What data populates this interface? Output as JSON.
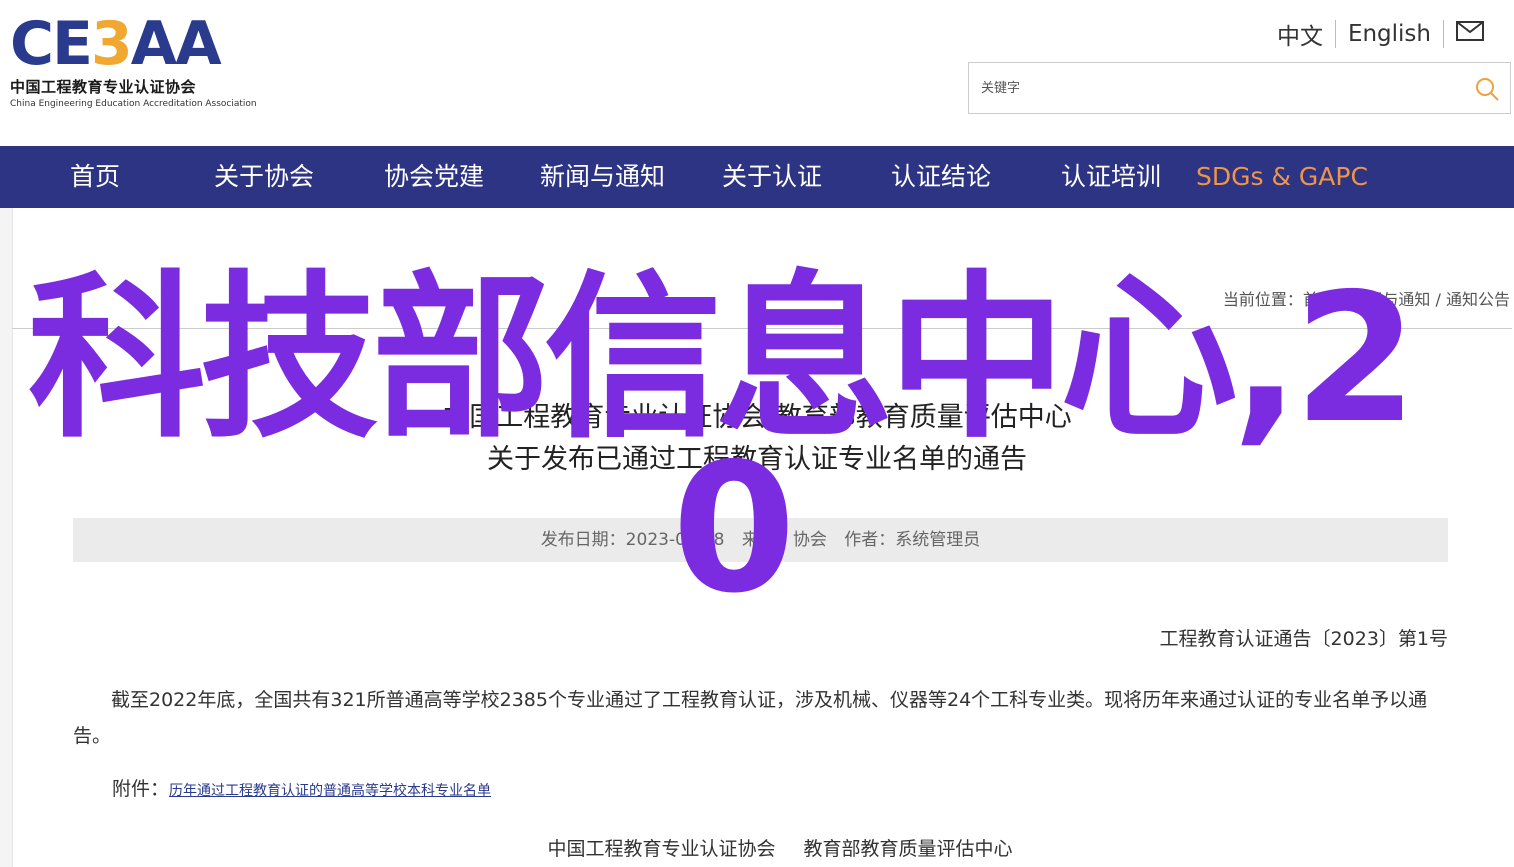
{
  "logo": {
    "mark_a": "CE",
    "mark_b": "3",
    "mark_c": "AA",
    "name_cn": "中国工程教育专业认证协会",
    "name_en": "China Engineering Education Accreditation Association"
  },
  "lang": {
    "zh": "中文",
    "en": "English",
    "mail_icon": "mail-icon"
  },
  "search": {
    "placeholder": "关键字",
    "icon": "search-icon"
  },
  "nav": {
    "items": [
      {
        "label": "首页"
      },
      {
        "label": "关于协会"
      },
      {
        "label": "协会党建"
      },
      {
        "label": "新闻与通知"
      },
      {
        "label": "关于认证"
      },
      {
        "label": "认证结论"
      },
      {
        "label": "认证培训"
      },
      {
        "label": "SDGs & GAPC"
      }
    ],
    "bg_color": "#2d3484",
    "highlight_color": "#f09448"
  },
  "breadcrumb": {
    "prefix": "当前位置：",
    "items": [
      "首页",
      "新闻与通知",
      "通知公告"
    ],
    "separator": " / "
  },
  "watermark": {
    "line1": "科技部信息中心,2",
    "line2": "0",
    "color": "#7b2be0"
  },
  "article": {
    "title_line1": "中国工程教育专业认证协会 教育部教育质量评估中心",
    "title_line2": "关于发布已通过工程教育认证专业名单的通告",
    "meta": {
      "date": "发布日期：2023-03-28",
      "source": "来源：协会",
      "author": "作者：系统管理员"
    },
    "doc_no": "工程教育认证通告〔2023〕第1号",
    "body": "截至2022年底，全国共有321所普通高等学校2385个专业通过了工程教育认证，涉及机械、仪器等24个工科专业类。现将历年来通过认证的专业名单予以通告。",
    "attachment_label": "附件：",
    "attachment_link": "历年通过工程教育认证的普通高等学校本科专业名单",
    "signers": [
      "中国工程教育专业认证协会",
      "教育部教育质量评估中心"
    ]
  }
}
